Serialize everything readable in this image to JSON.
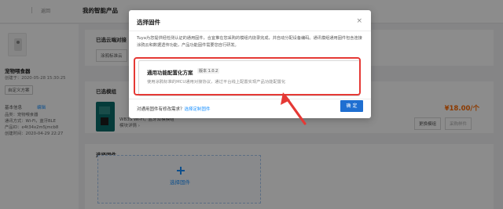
{
  "header": {
    "back_label": "返回",
    "page_title": "我的智能产品"
  },
  "product": {
    "name": "宠物喂食器",
    "date": "创建于：2020-05-28 15:30:25",
    "tag_button": "自定义方案",
    "info_title": "基本信息",
    "edit_label": "编辑",
    "info": [
      "品类：宠物喂食器",
      "通讯方式：Wi-Fi，蓝牙BLE",
      "产品ID：e4t34x2m5jmcb8",
      "创建时间：2020-04-29 22:27"
    ]
  },
  "main": {
    "selected_label": "已选云端对接",
    "cloud_btn": "涂鸦标准云",
    "module_section": "已选模组",
    "module_title": "WB3S Wi-Fi，蓝牙双模模组",
    "module_link": "模块详情 ›",
    "price": "¥18.00/个",
    "change_module": "更换模组",
    "buy_sample": "采购样件",
    "firmware_section": "选择固件",
    "select_firmware": "选择固件"
  },
  "modal": {
    "title": "选择固件",
    "description": "Tuya为您提供经检测认证的通用固件，合宜推在您采购的模组内烧录完成，并自动分配设备编码。通讯模组通用固件包含连接涂鸦云和数据透传功能，产品功能固件需要您自行研发。",
    "firmware": {
      "name": "通用功能配置化方案",
      "version": "版本 1.0.2",
      "description": "使用涂鸦标准的MCU通用对接协议，通过平台线上配置实现产品功能配置化"
    },
    "footer_question": "对通用固件有修改需求？",
    "footer_link": "选择定制固件",
    "ok_label": "确 定",
    "close_icon": "close-icon"
  },
  "colors": {
    "accent": "#1f6fd1",
    "highlight": "#e53935",
    "price": "#ff6a00"
  }
}
